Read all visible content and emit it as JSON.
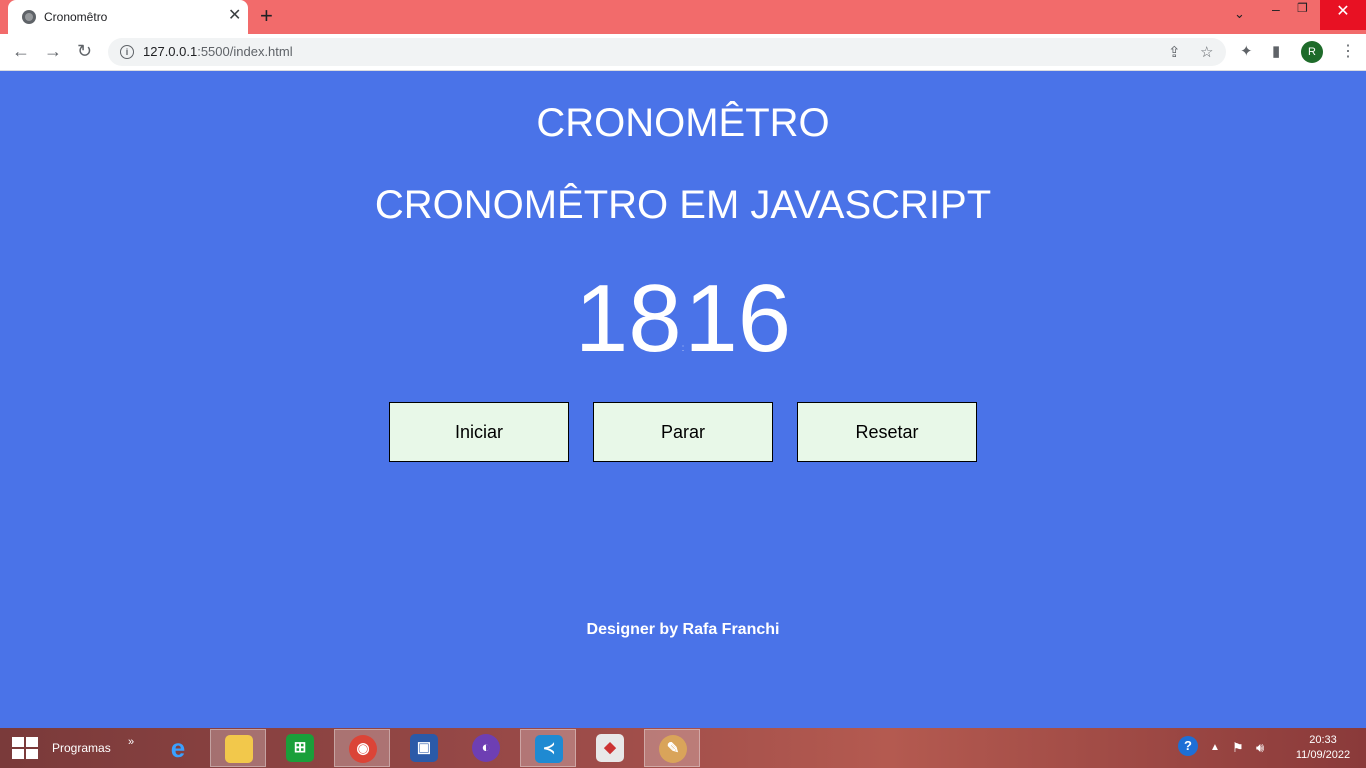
{
  "browser": {
    "tab_title": "Cronomêtro",
    "tab_close": "✕",
    "new_tab": "+",
    "url_host": "127.0.0.1",
    "url_rest": ":5500/index.html",
    "avatar_letter": "R"
  },
  "page": {
    "title": "CRONOMÊTRO",
    "subtitle": "CRONOMÊTRO EM JAVASCRIPT",
    "timer_left": "18",
    "timer_sep": ":",
    "timer_right": "16",
    "buttons": {
      "start": "Iniciar",
      "stop": "Parar",
      "reset": "Resetar"
    },
    "footer": "Designer by Rafa Franchi",
    "colors": {
      "background": "#4a73e8",
      "button_bg": "#e8f8e8",
      "text": "#ffffff"
    }
  },
  "taskbar": {
    "start_label": "Programas",
    "chevron": "»",
    "apps": [
      "internet-explorer",
      "file-explorer",
      "store",
      "chrome",
      "remote-desktop",
      "github",
      "vscode",
      "roblox",
      "paint"
    ],
    "time": "20:33",
    "date": "11/09/2022"
  }
}
